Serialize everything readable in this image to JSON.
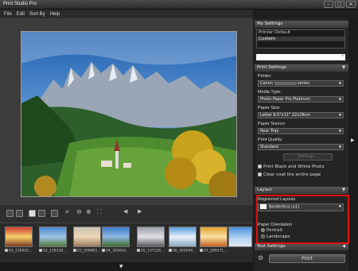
{
  "window": {
    "title": "Print Studio Pro",
    "min_label": "–",
    "max_label": "□",
    "close_label": "✕"
  },
  "menu": [
    "File",
    "Edit",
    "Sort By",
    "Help"
  ],
  "filmstrip": [
    {
      "label": "01_130025..."
    },
    {
      "label": "02_139138..."
    },
    {
      "label": "03_209893..."
    },
    {
      "label": "04_303016..."
    },
    {
      "label": "05_137126..."
    },
    {
      "label": "06_302049..."
    },
    {
      "label": "07_289271..."
    }
  ],
  "panel": {
    "my_settings": {
      "title": "My Settings",
      "items": [
        "Printer Default",
        "Custom"
      ],
      "add_label": "+"
    },
    "print_settings": {
      "title": "Print Settings",
      "printer_label": "Printer:",
      "printer_value": "Canon",
      "printer_suffix": "series",
      "media_type_label": "Media Type:",
      "media_type_value": "Photo Paper Pro Platinum",
      "paper_size_label": "Paper Size:",
      "paper_size_value": "Letter 8.5\"x11\" 22x28cm",
      "paper_source_label": "Paper Source:",
      "paper_source_value": "Rear Tray",
      "print_quality_label": "Print Quality:",
      "print_quality_value": "Standard",
      "settings_button": "Settings...",
      "bw_label": "Print Black and White Photo",
      "clear_coat_label": "Clear coat the entire page"
    },
    "layout": {
      "title": "Layout",
      "registered_label": "Registered Layouts",
      "registered_value": "Borderless (x1)",
      "orientation_label": "Paper Orientation",
      "portrait_label": "Portrait",
      "landscape_label": "Landscape",
      "orientation_selected": "Landscape"
    },
    "text_settings": {
      "title": "Text Settings"
    },
    "print_button": "Print"
  },
  "colors": {
    "highlight_box": "#e01010"
  }
}
